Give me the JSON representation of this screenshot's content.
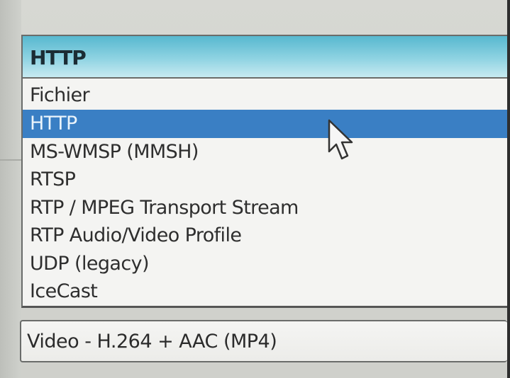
{
  "destination_combo": {
    "selected_value": "HTTP"
  },
  "destination_dropdown": {
    "options": [
      "Fichier",
      "HTTP",
      "MS-WMSP (MMSH)",
      "RTSP",
      "RTP / MPEG Transport Stream",
      "RTP Audio/Video Profile",
      "UDP (legacy)",
      "IceCast"
    ],
    "highlighted_index": 1
  },
  "profile_combo": {
    "selected_value": "Video - H.264 + AAC (MP4)"
  },
  "icons": {
    "pointer": "mouse-pointer-icon"
  },
  "colors": {
    "combo_highlight": "#57b8cf",
    "selection": "#3a7fc4",
    "list_background": "#f4f4f2"
  }
}
